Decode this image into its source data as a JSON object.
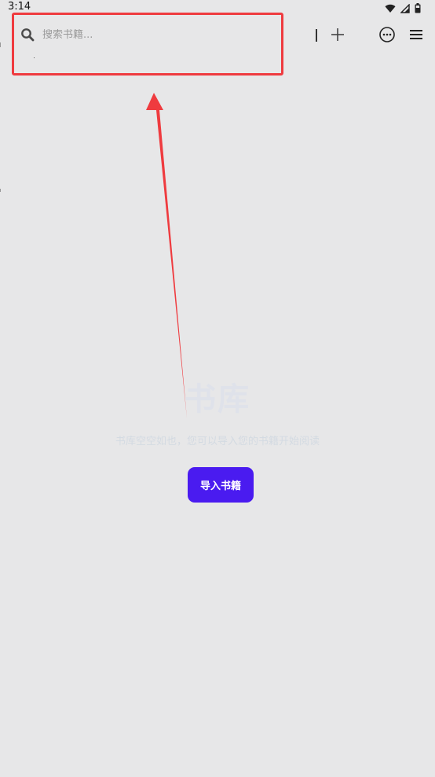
{
  "status_bar": {
    "time": "3:14",
    "icons": [
      "wifi-icon",
      "signal-icon",
      "battery-icon"
    ]
  },
  "search": {
    "placeholder": "搜索书籍..."
  },
  "toolbar": {
    "icons": [
      "plus-icon",
      "more-circle-icon",
      "hamburger-menu-icon"
    ]
  },
  "empty_state": {
    "title": "书库",
    "subtitle": "书库空空如也，您可以导入您的书籍开始阅读",
    "import_button_label": "导入书籍"
  },
  "colors": {
    "background": "#e7e7e8",
    "accent": "#4a1bf0",
    "annotation": "#ef3b3f"
  }
}
